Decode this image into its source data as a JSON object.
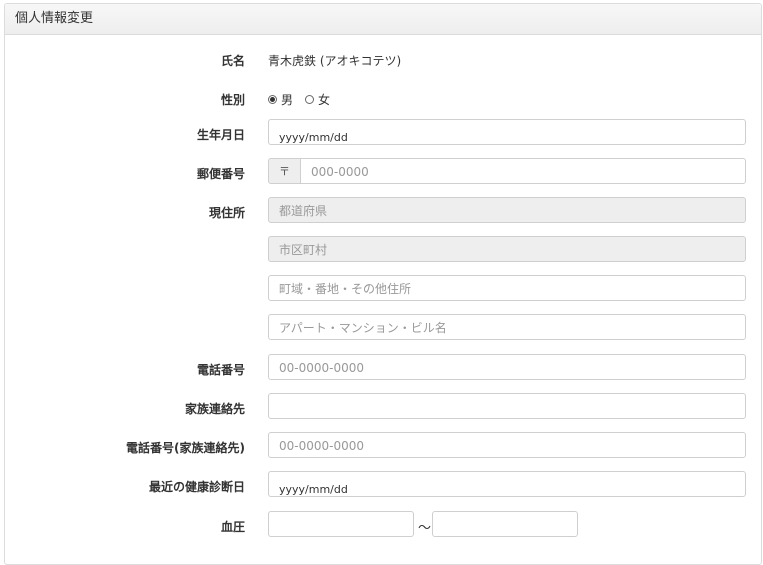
{
  "panel": {
    "title": "個人情報変更"
  },
  "name": {
    "label": "氏名",
    "value": "青木虎鉄 (アオキコテツ)"
  },
  "gender": {
    "label": "性別",
    "options": [
      "男",
      "女"
    ],
    "selected": "男"
  },
  "birthday": {
    "label": "生年月日",
    "placeholder": "yyyy/mm/dd"
  },
  "postal": {
    "label": "郵便番号",
    "prefix": "〒",
    "placeholder": "000-0000"
  },
  "address": {
    "label": "現住所",
    "prefecture_placeholder": "都道府県",
    "city_placeholder": "市区町村",
    "street_placeholder": "町域・番地・その他住所",
    "building_placeholder": "アパート・マンション・ビル名"
  },
  "phone": {
    "label": "電話番号",
    "placeholder": "00-0000-0000"
  },
  "family_contact": {
    "label": "家族連絡先",
    "value": ""
  },
  "family_phone": {
    "label": "電話番号(家族連絡先)",
    "placeholder": "00-0000-0000"
  },
  "checkup_date": {
    "label": "最近の健康診断日",
    "placeholder": "yyyy/mm/dd"
  },
  "blood_pressure": {
    "label": "血圧",
    "separator": "～"
  }
}
